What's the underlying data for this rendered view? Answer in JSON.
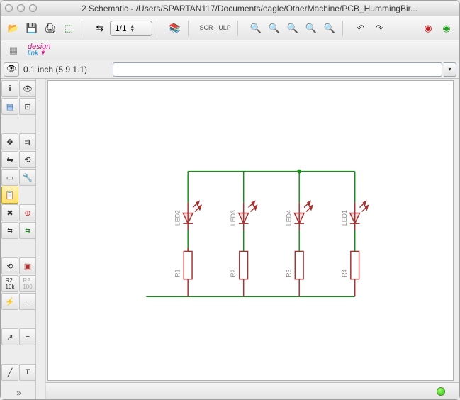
{
  "window": {
    "title": "2 Schematic - /Users/SPARTAN117/Documents/eagle/OtherMachine/PCB_HummingBir..."
  },
  "toolbar": {
    "sheet": "1/1"
  },
  "designlink": {
    "top": "design",
    "bottom": "link"
  },
  "coord": {
    "text": "0.1 inch (5.9 1.1)"
  },
  "command": {
    "value": "",
    "placeholder": ""
  },
  "components": [
    {
      "led": "LED2",
      "res": "R1"
    },
    {
      "led": "LED3",
      "res": "R2"
    },
    {
      "led": "LED4",
      "res": "R3"
    },
    {
      "led": "LED1",
      "res": "R4"
    }
  ]
}
